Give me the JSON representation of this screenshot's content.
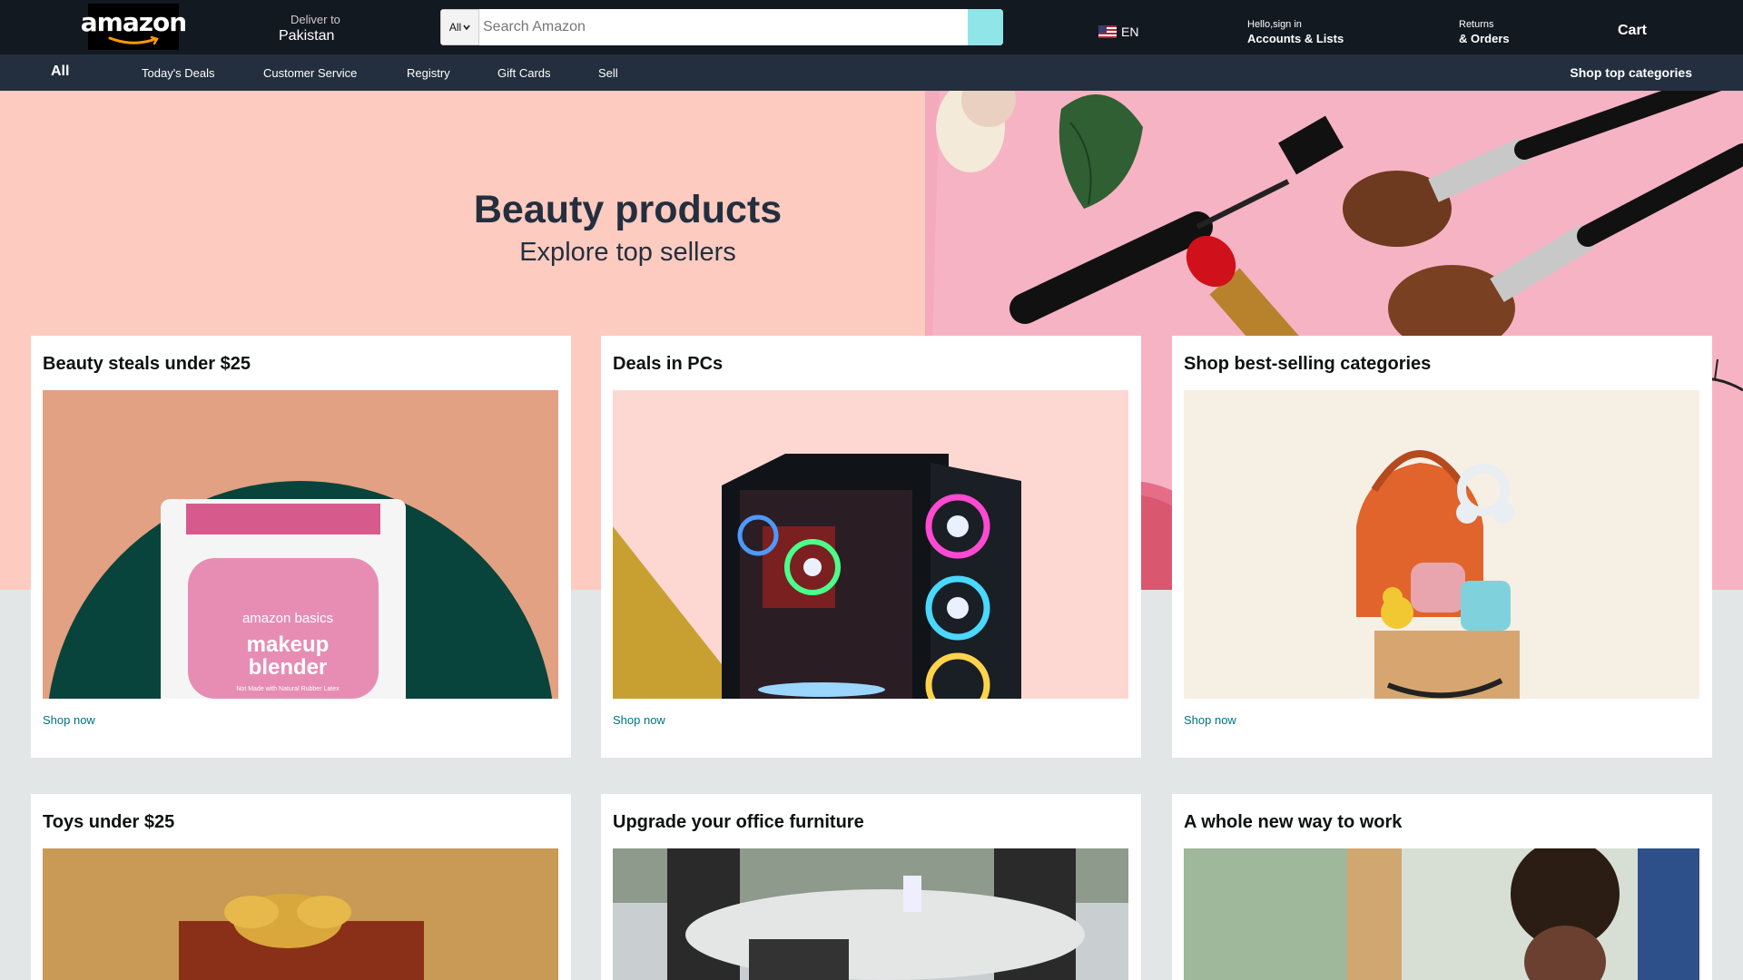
{
  "header": {
    "logo": "amazon",
    "deliver": {
      "line1": "Deliver to",
      "line2": "Pakistan"
    },
    "search": {
      "category": "All",
      "placeholder": "Search Amazon"
    },
    "language": "EN",
    "account": {
      "line1": "Hello,sign in",
      "line2": "Accounts & Lists"
    },
    "returns": {
      "line1": "Returns",
      "line2": "& Orders"
    },
    "cart": "Cart"
  },
  "subnav": {
    "all": "All",
    "items": [
      "Today's Deals",
      "Customer Service",
      "Registry",
      "Gift Cards",
      "Sell"
    ],
    "shop_top": "Shop top categories"
  },
  "hero": {
    "title": "Beauty products",
    "subtitle": "Explore top sellers"
  },
  "cards": [
    {
      "title": "Beauty steals under $25",
      "link": "Shop now",
      "image_text": [
        "amazon basics",
        "makeup",
        "blender",
        "Not Made with Natural Rubber Latex"
      ]
    },
    {
      "title": "Deals in PCs",
      "link": "Shop now"
    },
    {
      "title": "Shop best-selling categories",
      "link": "Shop now"
    },
    {
      "title": "Toys under $25"
    },
    {
      "title": "Upgrade your office furniture"
    },
    {
      "title": "A whole new way to work"
    }
  ],
  "colors": {
    "nav_bg": "#131921",
    "subnav_bg": "#232f3e",
    "hero_bg": "#fecbc0",
    "page_bg": "#e3e6e6",
    "link": "#007185",
    "search_button": "#90e5e9"
  }
}
